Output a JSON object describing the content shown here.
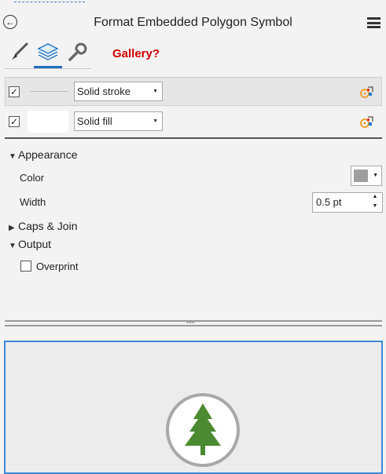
{
  "header": {
    "title": "Format Embedded Polygon Symbol",
    "back_icon": "back-arrow-circle-icon",
    "menu_icon": "hamburger-menu-icon"
  },
  "tabs": [
    {
      "name": "properties",
      "icon": "paintbrush-icon",
      "selected": false
    },
    {
      "name": "layers",
      "icon": "layers-icon",
      "selected": true
    },
    {
      "name": "structure",
      "icon": "wrench-icon",
      "selected": false
    }
  ],
  "annotation": {
    "text": "Gallery?",
    "color": "#d10000"
  },
  "layers": [
    {
      "checked": true,
      "type": "Solid stroke",
      "preview": "stroke-line",
      "options_icon": "layer-options-icon"
    },
    {
      "checked": true,
      "type": "Solid fill",
      "preview": "white-fill",
      "options_icon": "layer-options-icon"
    }
  ],
  "appearance": {
    "heading": "Appearance",
    "color_label": "Color",
    "color_value": "#9e9e9e",
    "width_label": "Width",
    "width_value": "0.5 pt"
  },
  "caps_join": {
    "heading": "Caps & Join"
  },
  "output": {
    "heading": "Output",
    "overprint_label": "Overprint",
    "overprint_checked": false
  },
  "preview": {
    "symbol_icon": "pine-tree-symbol-icon",
    "accent": "#3d88d6"
  }
}
